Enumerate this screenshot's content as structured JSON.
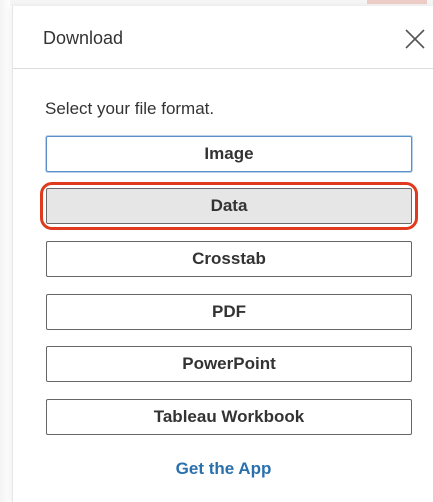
{
  "dialog": {
    "title": "Download",
    "close_icon": "close-icon",
    "prompt": "Select your file format.",
    "formats": [
      {
        "label": "Image",
        "state": "focused"
      },
      {
        "label": "Data",
        "state": "selected"
      },
      {
        "label": "Crosstab",
        "state": "normal"
      },
      {
        "label": "PDF",
        "state": "normal"
      },
      {
        "label": "PowerPoint",
        "state": "normal"
      },
      {
        "label": "Tableau Workbook",
        "state": "normal"
      }
    ],
    "get_app_link": "Get the App"
  },
  "colors": {
    "link": "#2a70ad",
    "highlight": "#e03a1e",
    "selected_bg": "#e6e6e6",
    "focus_border": "#5b8fc7"
  }
}
